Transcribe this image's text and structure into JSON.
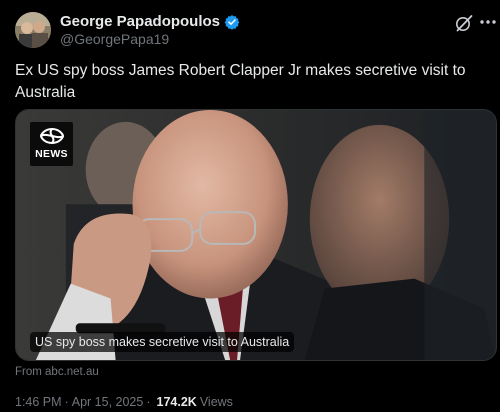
{
  "author": {
    "display_name": "George Papadopoulos",
    "handle": "@GeorgePapa19",
    "verified": true
  },
  "tweet": {
    "text": "Ex US spy boss James Robert Clapper Jr makes secretive visit to Australia"
  },
  "card": {
    "logo_text": "NEWS",
    "caption": "US spy boss makes secretive visit to Australia",
    "source": "From abc.net.au"
  },
  "meta": {
    "time": "1:46 PM",
    "separator": "·",
    "date": "Apr 15, 2025",
    "views_count": "174.2K",
    "views_label": "Views"
  },
  "icons": {
    "verified": "verified-badge-icon",
    "grok": "grok-icon",
    "more": "more-options-icon",
    "abc": "abc-logo-icon"
  },
  "colors": {
    "background": "#000000",
    "text": "#e7e9ea",
    "secondary": "#71767b",
    "verified": "#1d9bf0"
  }
}
